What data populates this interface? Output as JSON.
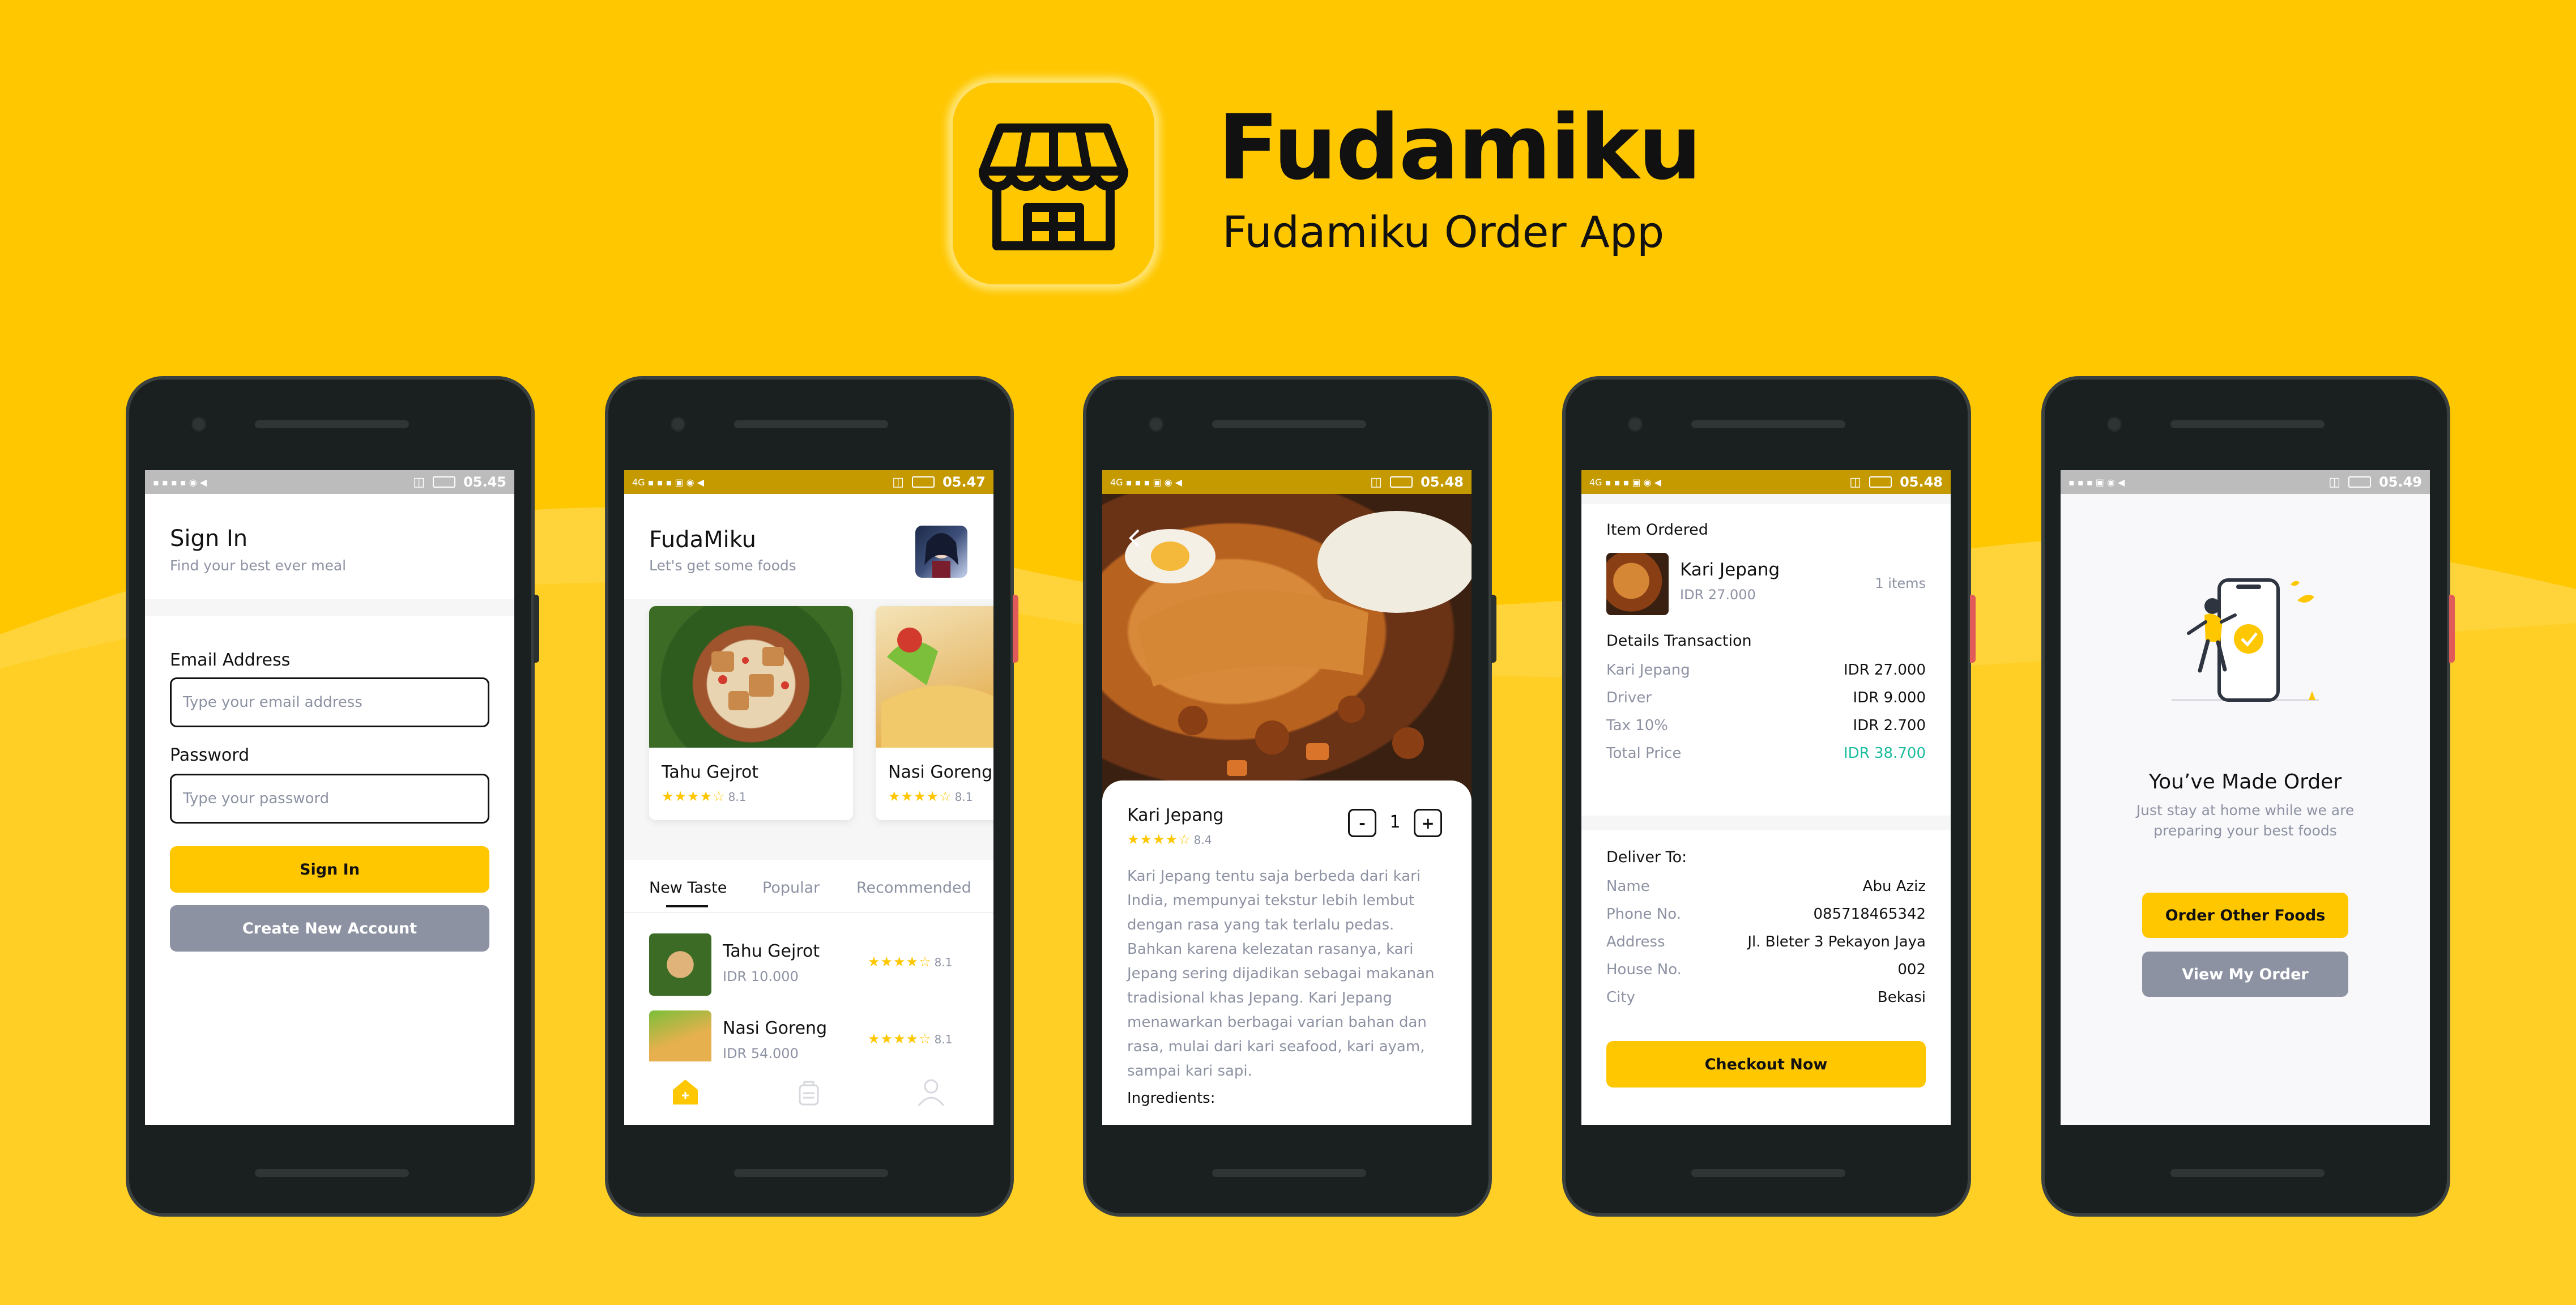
{
  "colors": {
    "primary": "#FFC700",
    "secondary": "#8D92A3",
    "accent_green": "#1ABC9C",
    "dark": "#111111"
  },
  "header": {
    "title": "Fudamiku",
    "subtitle": "Fudamiku Order App",
    "logo_icon": "store-icon"
  },
  "phone1": {
    "status_time": "05.45",
    "title": "Sign In",
    "subtitle": "Find your best ever meal",
    "email_label": "Email Address",
    "email_placeholder": "Type your email address",
    "password_label": "Password",
    "password_placeholder": "Type your password",
    "signin_button": "Sign In",
    "create_button": "Create New Account"
  },
  "phone2": {
    "status_time": "05.47",
    "title": "FudaMiku",
    "subtitle": "Let's get some foods",
    "cards": [
      {
        "name": "Tahu Gejrot",
        "rating": "8.1",
        "stars": 4
      },
      {
        "name": "Nasi Goreng",
        "rating": "8.1",
        "stars": 4
      }
    ],
    "tabs": [
      "New Taste",
      "Popular",
      "Recommended"
    ],
    "list": [
      {
        "name": "Tahu Gejrot",
        "price": "IDR 10.000",
        "rating": "8.1",
        "stars": 4
      },
      {
        "name": "Nasi Goreng",
        "price": "IDR 54.000",
        "rating": "8.1",
        "stars": 4
      }
    ],
    "nav_icons": [
      "home-icon",
      "order-bag-icon",
      "profile-icon"
    ]
  },
  "phone3": {
    "status_time": "05.48",
    "name": "Kari Jepang",
    "rating": "8.4",
    "stars": 4,
    "quantity": "1",
    "minus": "-",
    "plus": "+",
    "description": "Kari Jepang tentu saja berbeda dari kari India, mempunyai tekstur lebih lembut dengan rasa yang tak terlalu pedas. Bahkan karena kelezatan rasanya, kari Jepang sering dijadikan sebagai makanan tradisional khas Jepang. Kari Jepang menawarkan berbagai varian bahan dan rasa, mulai dari kari seafood, kari ayam, sampai kari sapi.",
    "ingredients_label": "Ingredients:"
  },
  "phone4": {
    "status_time": "05.48",
    "item_ordered_label": "Item Ordered",
    "item": {
      "name": "Kari Jepang",
      "price": "IDR 27.000",
      "qty": "1 items"
    },
    "details_label": "Details Transaction",
    "details": [
      {
        "label": "Kari Jepang",
        "value": "IDR 27.000"
      },
      {
        "label": "Driver",
        "value": "IDR 9.000"
      },
      {
        "label": "Tax 10%",
        "value": "IDR 2.700"
      },
      {
        "label": "Total Price",
        "value": "IDR 38.700"
      }
    ],
    "deliver_label": "Deliver To:",
    "deliver": [
      {
        "label": "Name",
        "value": "Abu Aziz"
      },
      {
        "label": "Phone No.",
        "value": "085718465342"
      },
      {
        "label": "Address",
        "value": "Jl. Bleter 3 Pekayon Jaya"
      },
      {
        "label": "House No.",
        "value": "002"
      },
      {
        "label": "City",
        "value": "Bekasi"
      }
    ],
    "checkout_button": "Checkout Now"
  },
  "phone5": {
    "status_time": "05.49",
    "title": "You’ve Made Order",
    "subtitle_line1": "Just stay at home while we are",
    "subtitle_line2": "preparing your best foods",
    "order_other_button": "Order Other Foods",
    "view_order_button": "View My Order"
  }
}
